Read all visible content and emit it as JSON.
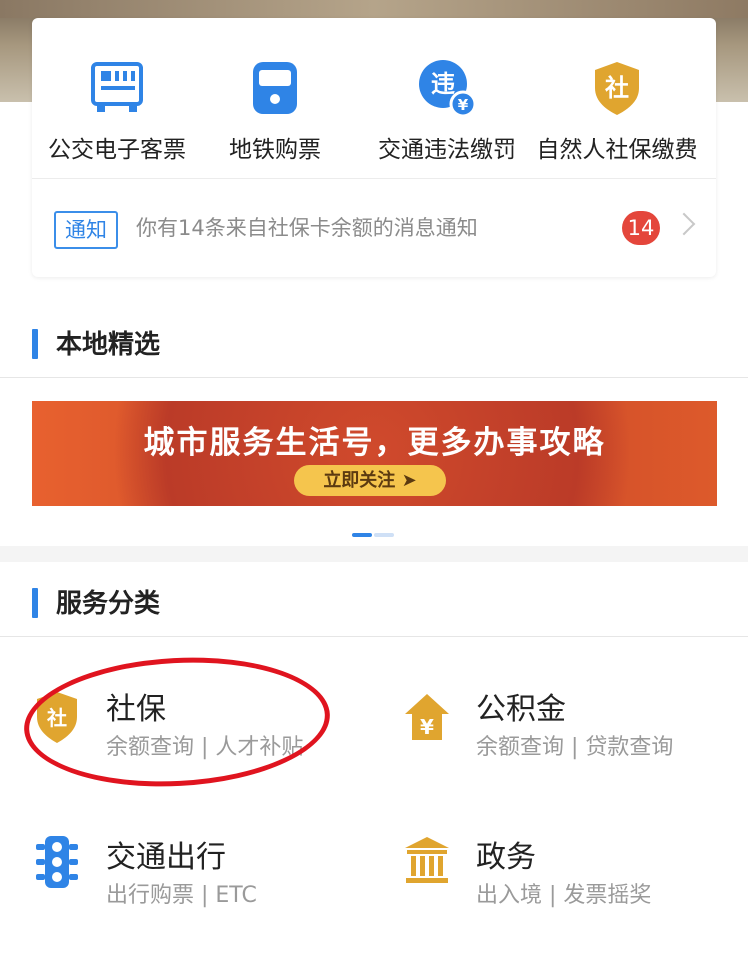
{
  "quick_services": [
    {
      "label": "公交电子客票",
      "icon": "bus-ticket-qr-icon"
    },
    {
      "label": "地铁购票",
      "icon": "subway-train-icon"
    },
    {
      "label": "交通违法缴罚",
      "icon": "traffic-violation-fine-icon",
      "icon_text": "违",
      "icon_sub": "¥"
    },
    {
      "label": "自然人社保缴费",
      "icon": "social-security-shield-icon",
      "icon_text": "社"
    }
  ],
  "notice": {
    "tag": "通知",
    "text": "你有14条来自社保卡余额的消息通知",
    "count": "14"
  },
  "local_section": {
    "title": "本地精选"
  },
  "promo": {
    "headline": "城市服务生活号，更多办事攻略",
    "cta": "立即关注 ➤"
  },
  "services_section": {
    "title": "服务分类"
  },
  "services": [
    {
      "name": "社保",
      "desc": "余额查询 | 人才补贴",
      "icon": "social-security-shield-icon",
      "icon_text": "社"
    },
    {
      "name": "公积金",
      "desc": "余额查询 | 贷款查询",
      "icon": "housing-fund-house-icon",
      "icon_text": "¥"
    },
    {
      "name": "交通出行",
      "desc": "出行购票 | ETC",
      "icon": "traffic-light-icon"
    },
    {
      "name": "政务",
      "desc": "出入境 | 发票摇奖",
      "icon": "government-building-icon"
    }
  ],
  "colors": {
    "accent": "#2f84e6",
    "gold": "#e0a52f",
    "badge": "#e4463b",
    "highlight_circle": "#e0141f"
  }
}
